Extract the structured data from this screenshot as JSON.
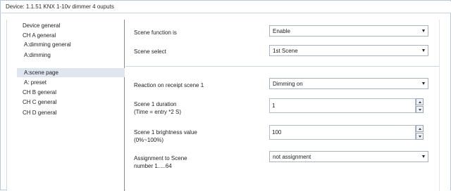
{
  "window": {
    "title": "Device: 1.1.51  KNX 1-10v dimmer  4 ouputs"
  },
  "sidebar": {
    "items": [
      {
        "label": "Device general"
      },
      {
        "label": "CH A general"
      },
      {
        "label": "A:dimming general"
      },
      {
        "label": "A:dimming"
      },
      {
        "label": "A:scene page",
        "selected": true
      },
      {
        "label": "A: preset"
      },
      {
        "label": "CH B general"
      },
      {
        "label": "CH C general"
      },
      {
        "label": "CH D general"
      }
    ]
  },
  "params": {
    "scene_function": {
      "label": "Scene function is",
      "value": "Enable"
    },
    "scene_select": {
      "label": "Scene  select",
      "value": "1st Scene"
    },
    "reaction": {
      "label": "Reaction on receipt scene 1",
      "value": "Dimming on"
    },
    "duration": {
      "label_line1": "Scene 1 duration",
      "label_line2": "(Time = entry *2 S)",
      "value": "1"
    },
    "brightness": {
      "label_line1": "Scene 1 brightness value",
      "label_line2": "(0%~100%)",
      "value": "100"
    },
    "assignment": {
      "label_line1": "Assignment to Scene",
      "label_line2": "number 1.....64",
      "value": "not assignment"
    }
  },
  "icons": {
    "dropdown_arrow": "chevron-down-icon",
    "spin_up": "spin-up-icon",
    "spin_down": "spin-down-icon"
  },
  "colors": {
    "selected_item_bg": "#dfe6f0",
    "frame_border": "#b9c7da"
  }
}
